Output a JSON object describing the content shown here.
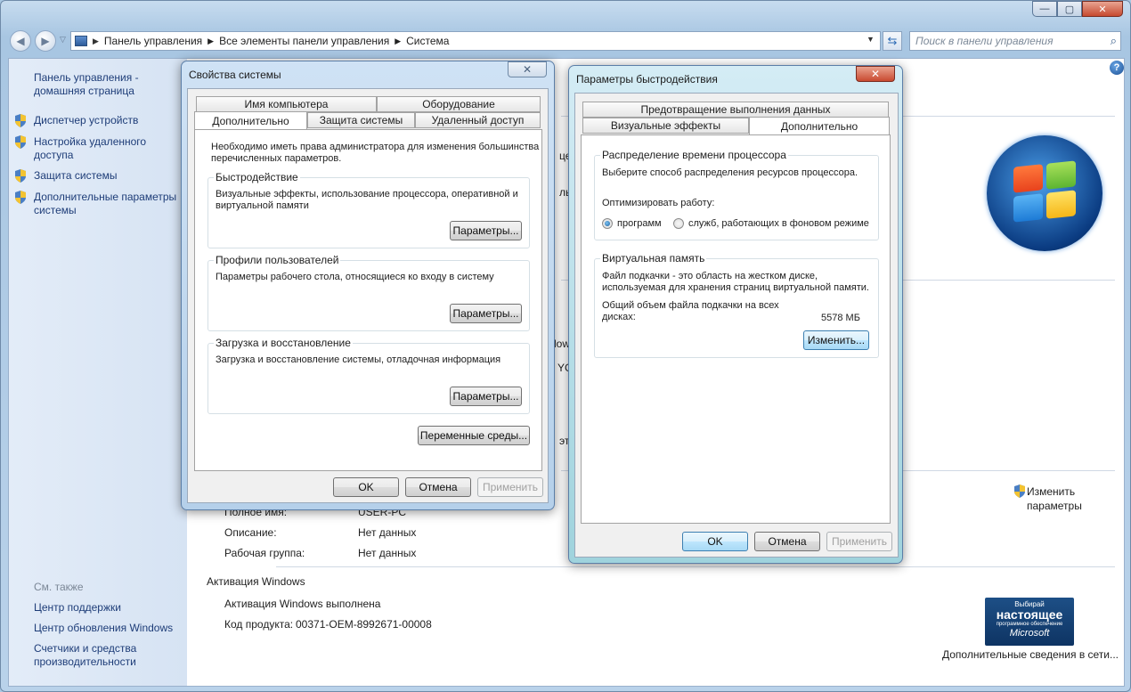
{
  "explorer": {
    "breadcrumb": [
      "Панель управления",
      "Все элементы панели управления",
      "Система"
    ],
    "search_placeholder": "Поиск в панели управления",
    "title_buttons": {
      "minimize": "—",
      "maximize": "▢",
      "close": "✕"
    }
  },
  "sidebar": {
    "home_line1": "Панель управления -",
    "home_line2": "домашняя страница",
    "items": [
      {
        "line1": "Диспетчер устройств",
        "line2": ""
      },
      {
        "line1": "Настройка удаленного",
        "line2": "доступа"
      },
      {
        "line1": "Защита системы",
        "line2": ""
      },
      {
        "line1": "Дополнительные параметры",
        "line2": "системы"
      }
    ],
    "see_also": "См. также",
    "see_also_items": [
      {
        "line1": "Центр поддержки",
        "line2": ""
      },
      {
        "line1": "Центр обновления Windows",
        "line2": ""
      },
      {
        "line1": "Счетчики и средства",
        "line2": "производительности"
      }
    ]
  },
  "main": {
    "fullname_label": "Полное имя:",
    "fullname_value": "USER-PC",
    "description_label": "Описание:",
    "description_value": "Нет данных",
    "workgroup_label": "Рабочая группа:",
    "workgroup_value": "Нет данных",
    "change_link_line1": "Изменить",
    "change_link_line2": "параметры",
    "activation_header": "Активация Windows",
    "activation_status": "Активация Windows выполнена",
    "product_key_label": "Код продукта:",
    "product_key_value": "00371-OEM-8992671-00008",
    "genuine_badge": {
      "line1": "Выбирай",
      "line2": "настоящее",
      "line3": "программное обеспечение",
      "line4": "Microsoft"
    },
    "more_info_link": "Дополнительные сведения в сети...",
    "partial_texts": [
      "це",
      "лы",
      "lowv",
      "YGH",
      "эт"
    ]
  },
  "system_properties": {
    "title": "Свойства системы",
    "tabs_back": [
      "Имя компьютера",
      "Оборудование"
    ],
    "tabs_front": [
      "Дополнительно",
      "Защита системы",
      "Удаленный доступ"
    ],
    "admin_note": "Необходимо иметь права администратора для изменения большинства перечисленных параметров.",
    "groups": [
      {
        "title": "Быстродействие",
        "text": "Визуальные эффекты, использование процессора, оперативной и виртуальной памяти",
        "button": "Параметры..."
      },
      {
        "title": "Профили пользователей",
        "text": "Параметры рабочего стола, относящиеся ко входу в систему",
        "button": "Параметры..."
      },
      {
        "title": "Загрузка и восстановление",
        "text": "Загрузка и восстановление системы, отладочная информация",
        "button": "Параметры..."
      }
    ],
    "env_button": "Переменные среды...",
    "ok": "OK",
    "cancel": "Отмена",
    "apply": "Применить"
  },
  "performance_options": {
    "title": "Параметры быстродействия",
    "tab_back": "Предотвращение выполнения данных",
    "tabs_front": [
      "Визуальные эффекты",
      "Дополнительно"
    ],
    "cpu_group_title": "Распределение времени процессора",
    "cpu_desc": "Выберите способ распределения ресурсов процессора.",
    "optimize_label": "Оптимизировать работу:",
    "radio_programs": "программ",
    "radio_services": "служб, работающих в фоновом режиме",
    "vm_group_title": "Виртуальная память",
    "vm_desc": "Файл подкачки - это область на жестком диске, используемая для хранения страниц виртуальной памяти.",
    "total_label": "Общий объем файла подкачки на всех дисках:",
    "total_value": "5578 МБ",
    "change_button": "Изменить...",
    "ok": "OK",
    "cancel": "Отмена",
    "apply": "Применить"
  }
}
